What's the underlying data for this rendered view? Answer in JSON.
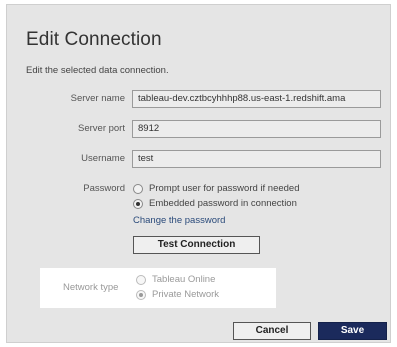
{
  "dialog": {
    "title": "Edit Connection",
    "subtitle": "Edit the selected data connection."
  },
  "form": {
    "server_name": {
      "label": "Server name",
      "value": "tableau-dev.cztbcyhhhp88.us-east-1.redshift.ama"
    },
    "server_port": {
      "label": "Server port",
      "value": "8912"
    },
    "username": {
      "label": "Username",
      "value": "test"
    },
    "password": {
      "label": "Password",
      "options": [
        {
          "label": "Prompt user for password if needed",
          "checked": false
        },
        {
          "label": "Embedded password in connection",
          "checked": true
        }
      ],
      "change_link": "Change the password"
    },
    "test_button": "Test Connection"
  },
  "network": {
    "label": "Network type",
    "options": [
      {
        "label": "Tableau Online",
        "checked": false
      },
      {
        "label": "Private Network",
        "checked": true
      }
    ]
  },
  "footer": {
    "cancel_label": "Cancel",
    "save_label": "Save"
  },
  "colors": {
    "dialog_bg": "#e5e5e5",
    "save_bg": "#1b2a5c",
    "link": "#2a4a7a"
  }
}
